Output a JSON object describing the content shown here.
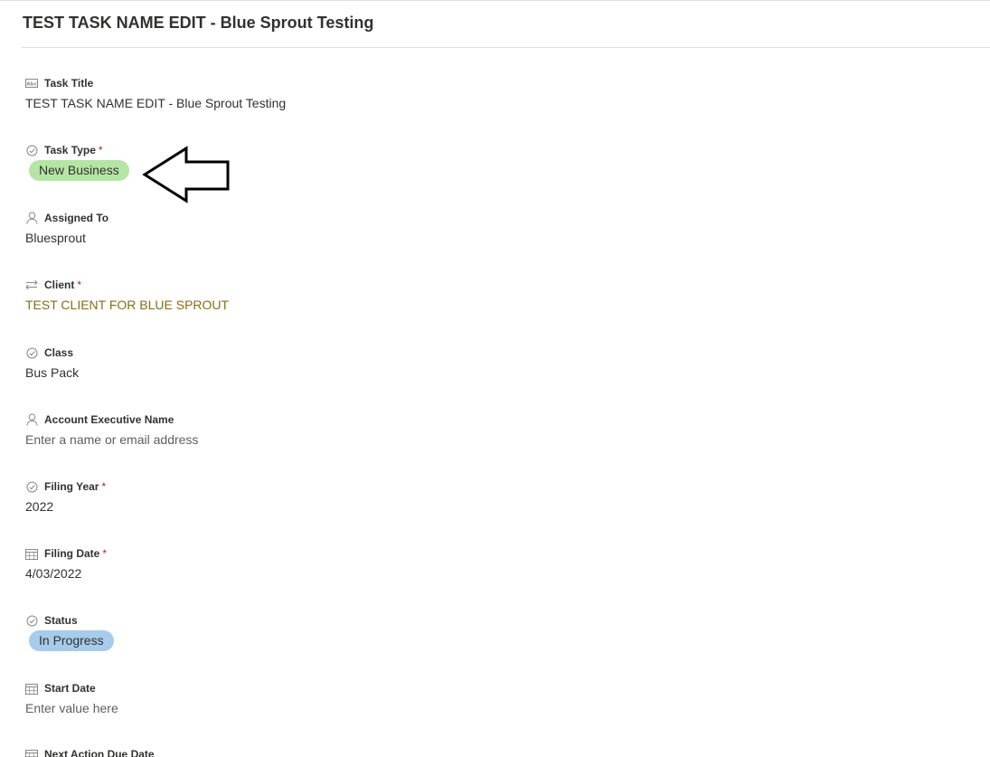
{
  "header": {
    "title": "TEST TASK NAME EDIT - Blue Sprout Testing"
  },
  "fields": {
    "task_title": {
      "label": "Task Title",
      "icon": "text-field-icon",
      "value": "TEST TASK NAME EDIT - Blue Sprout Testing"
    },
    "task_type": {
      "label": "Task Type",
      "required": "*",
      "icon": "choice-icon",
      "value": "New Business",
      "pill_color": "#b5e5a4"
    },
    "assigned_to": {
      "label": "Assigned To",
      "icon": "person-icon",
      "value": "Bluesprout"
    },
    "client": {
      "label": "Client",
      "required": "*",
      "icon": "lookup-icon",
      "value": "TEST CLIENT FOR BLUE SPROUT",
      "value_color": "#8a6b10"
    },
    "class": {
      "label": "Class",
      "icon": "choice-icon",
      "value": "Bus Pack"
    },
    "account_executive": {
      "label": "Account Executive Name",
      "icon": "person-icon",
      "placeholder": "Enter a name or email address"
    },
    "filing_year": {
      "label": "Filing Year",
      "required": "*",
      "icon": "choice-icon",
      "value": "2022"
    },
    "filing_date": {
      "label": "Filing Date",
      "required": "*",
      "icon": "calendar-icon",
      "value": "4/03/2022"
    },
    "status": {
      "label": "Status",
      "icon": "choice-icon",
      "value": "In Progress",
      "pill_color": "#a6cbeb"
    },
    "start_date": {
      "label": "Start Date",
      "icon": "calendar-icon",
      "placeholder": "Enter value here"
    },
    "next_action_due_date": {
      "label": "Next Action Due Date",
      "icon": "calendar-icon"
    }
  },
  "annotation": {
    "icon": "left-arrow-icon"
  }
}
